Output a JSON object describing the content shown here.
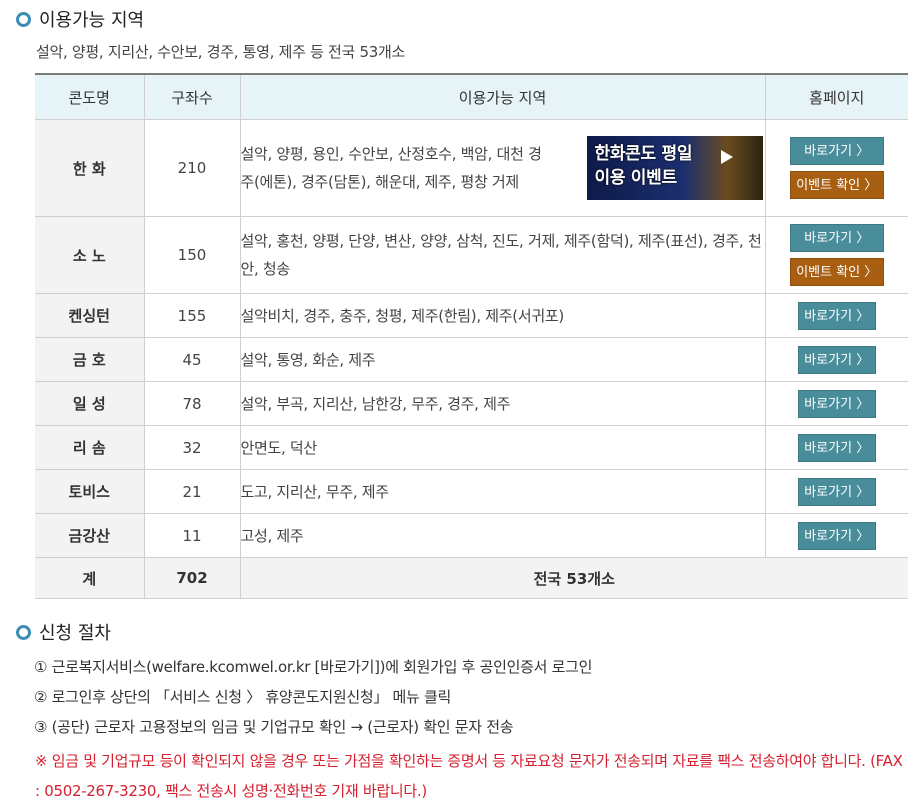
{
  "section1": {
    "title": "이용가능 지역",
    "subtitle": "설악, 양평, 지리산, 수안보, 경주, 통영, 제주 등 전국 53개소"
  },
  "table": {
    "headers": [
      "콘도명",
      "구좌수",
      "이용가능 지역",
      "홈페이지"
    ],
    "rows": [
      {
        "name": "한 화",
        "count": "210",
        "area": "설악, 양평, 용인, 수안보, 산정호수, 백암, 대천 경주(에톤), 경주(담톤), 해운대, 제주, 평창 거제",
        "link": "바로가기 〉",
        "event": "이벤트 확인 〉"
      },
      {
        "name": "소 노",
        "count": "150",
        "area": "설악, 홍천, 양평, 단양, 변산, 양양, 삼척, 진도, 거제, 제주(함덕), 제주(표선), 경주, 천안, 청송",
        "link": "바로가기 〉",
        "event": "이벤트 확인 〉"
      },
      {
        "name": "켄싱턴",
        "count": "155",
        "area": "설악비치, 경주, 충주, 청평, 제주(한림), 제주(서귀포)",
        "link": "바로가기 〉"
      },
      {
        "name": "금 호",
        "count": "45",
        "area": "설악, 통영, 화순, 제주",
        "link": "바로가기 〉"
      },
      {
        "name": "일 성",
        "count": "78",
        "area": "설악, 부곡, 지리산, 남한강, 무주, 경주, 제주",
        "link": "바로가기 〉"
      },
      {
        "name": "리 솜",
        "count": "32",
        "area": "안면도, 덕산",
        "link": "바로가기 〉"
      },
      {
        "name": "토비스",
        "count": "21",
        "area": "도고, 지리산, 무주, 제주",
        "link": "바로가기 〉"
      },
      {
        "name": "금강산",
        "count": "11",
        "area": "고성, 제주",
        "link": "바로가기 〉"
      }
    ],
    "total": {
      "label": "계",
      "count": "702",
      "summary": "전국 53개소"
    },
    "promo": {
      "line1": "한화콘도 평일",
      "line2": "이용 이벤트"
    }
  },
  "section2": {
    "title": "신청 절차",
    "steps": [
      "① 근로복지서비스(welfare.kcomwel.or.kr [바로가기])에 회원가입 후 공인인증서 로그인",
      "② 로그인후 상단의 「서비스 신청 〉 휴양콘도지원신청」 메뉴 클릭",
      "③ (공단) 근로자 고용정보의 임금 및 기업규모 확인 → (근로자) 확인 문자 전송"
    ],
    "note": "※ 임금 및 기업규모 등이 확인되지 않을 경우 또는 가점을 확인하는 증명서 등 자료요청 문자가 전송되며 자료를 팩스 전송하여야 합니다. (FAX : 0502-267-3230, 팩스 전송시 성명·전화번호 기재 바랍니다.)"
  },
  "colors": {
    "accent": "#3b8db3",
    "header_bg": "#e6f3f7",
    "button_go": "#4a8d9a",
    "button_event": "#a85f12",
    "note_red": "#d6202f"
  }
}
